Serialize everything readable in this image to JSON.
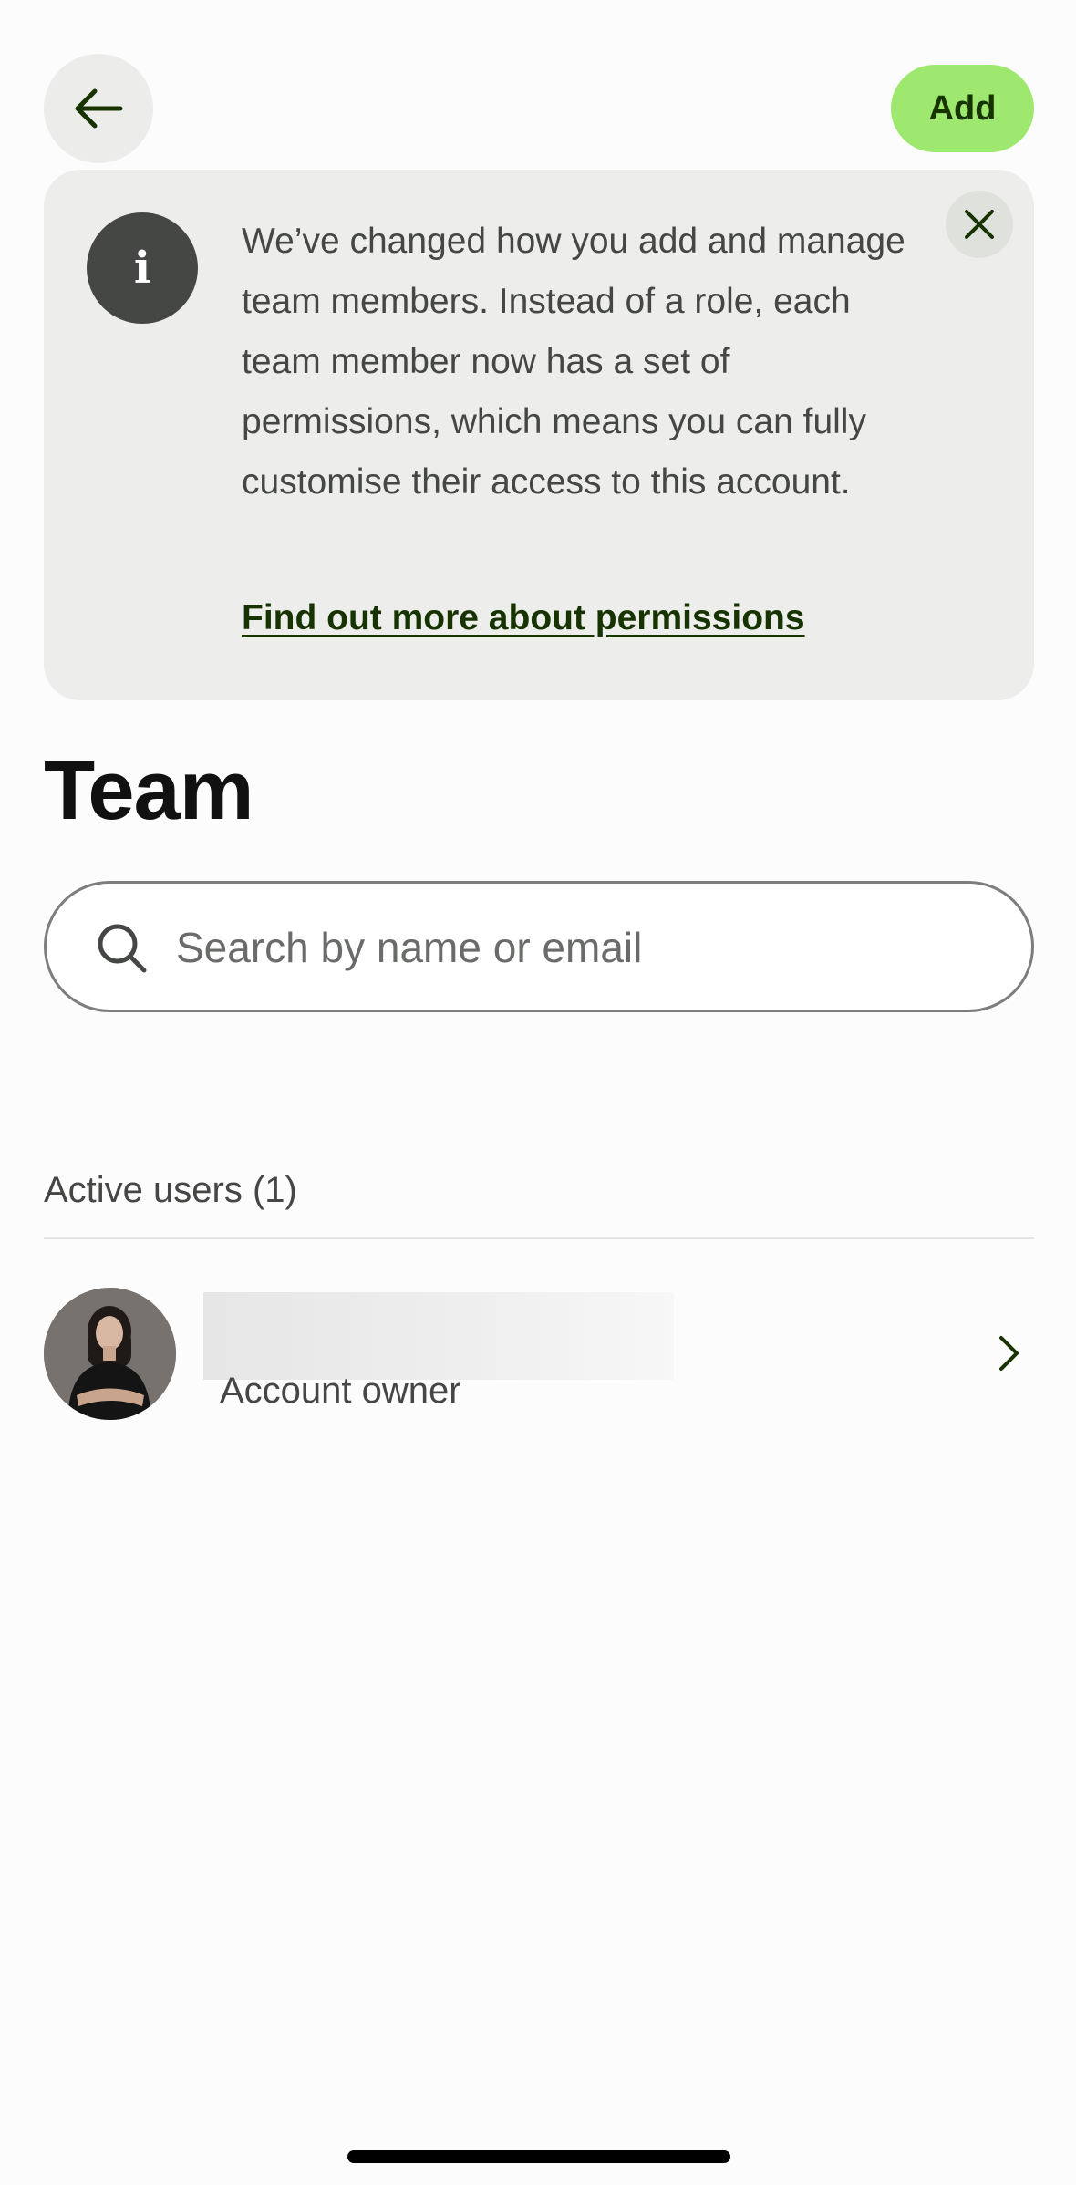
{
  "header": {
    "add_label": "Add"
  },
  "banner": {
    "text": "We’ve changed how you add and manage team members. Instead of a role, each team member now has a set of permissions, which means you can fully customise their access to this account.",
    "link_label": "Find out more about permissions",
    "info_glyph": "i"
  },
  "page": {
    "title": "Team"
  },
  "search": {
    "placeholder": "Search by name or email"
  },
  "active_users": {
    "header": "Active users (1)",
    "users": [
      {
        "role": "Account owner"
      }
    ]
  },
  "colors": {
    "accent": "#9fe870",
    "accent_text": "#163300",
    "banner_bg": "#edeeec",
    "info_icon_bg": "#454745"
  }
}
